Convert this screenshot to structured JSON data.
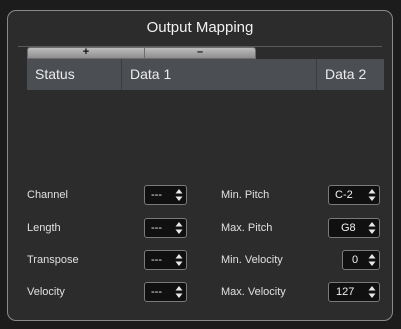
{
  "panel": {
    "title": "Output Mapping",
    "add_label": "+",
    "remove_label": "–"
  },
  "table": {
    "columns": [
      "Status",
      "Data 1",
      "Data 2"
    ]
  },
  "fields_left": [
    {
      "label": "Channel",
      "value": "---"
    },
    {
      "label": "Length",
      "value": "---"
    },
    {
      "label": "Transpose",
      "value": "---"
    },
    {
      "label": "Velocity",
      "value": "---"
    }
  ],
  "fields_right": [
    {
      "label": "Min. Pitch",
      "value": "C-2"
    },
    {
      "label": "Max. Pitch",
      "value": "G8"
    },
    {
      "label": "Min. Velocity",
      "value": "0"
    },
    {
      "label": "Max. Velocity",
      "value": "127"
    }
  ],
  "icons": {
    "spinner": "up-down-arrows-icon"
  }
}
